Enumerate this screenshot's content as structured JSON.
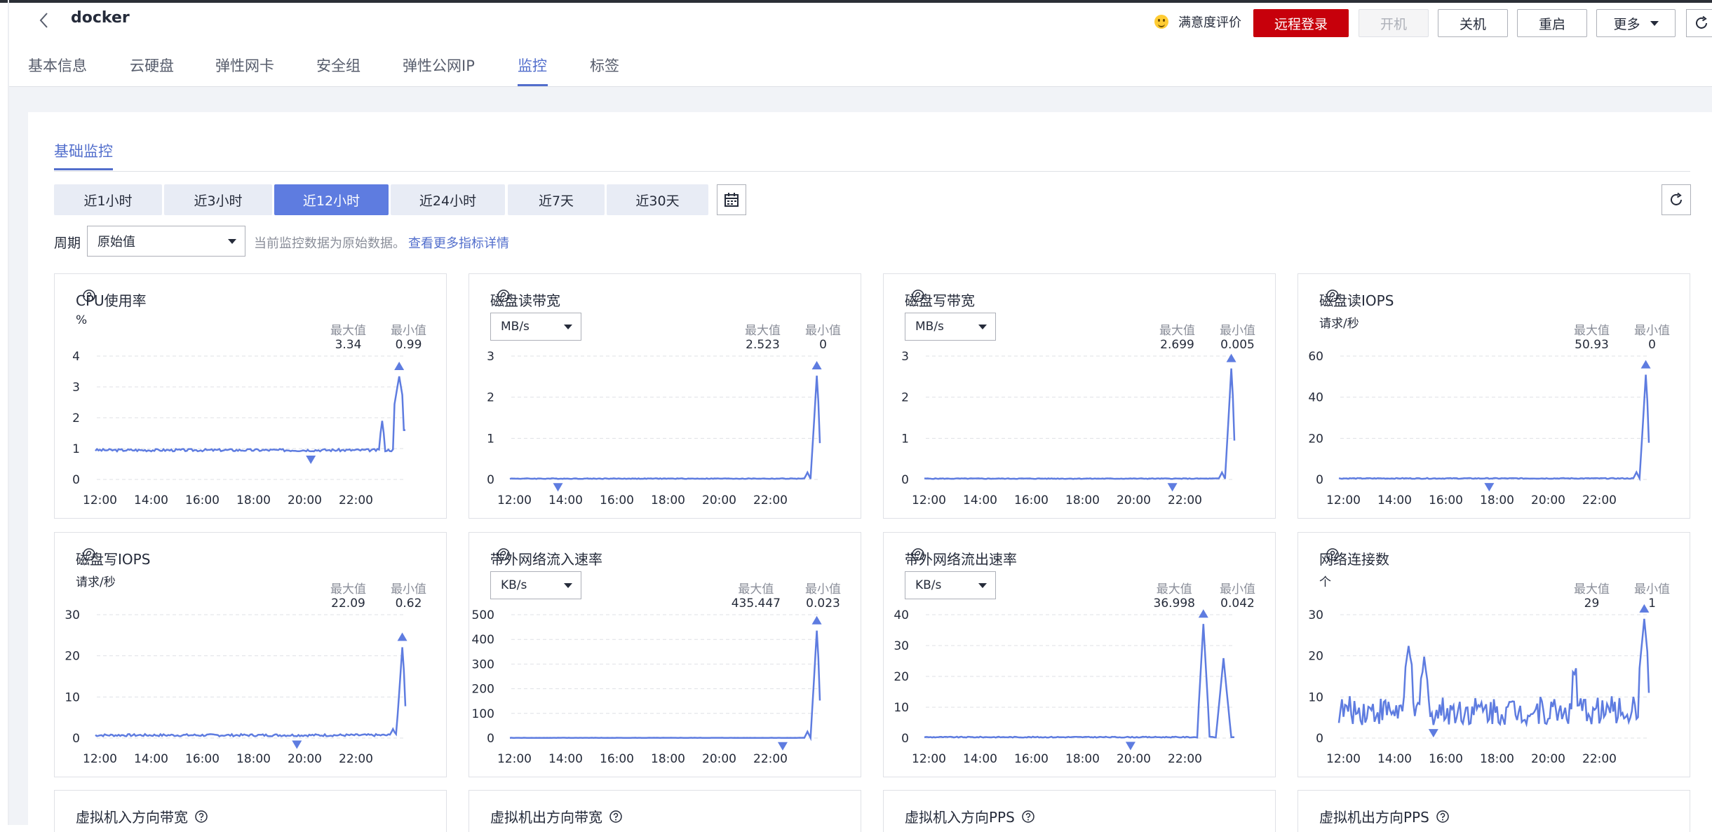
{
  "header": {
    "title": "docker",
    "satisfaction": "满意度评价",
    "buttons": {
      "remote_login": "远程登录",
      "start": "开机",
      "shutdown": "关机",
      "restart": "重启",
      "more": "更多"
    }
  },
  "tabs": [
    "基本信息",
    "云硬盘",
    "弹性网卡",
    "安全组",
    "弹性公网IP",
    "监控",
    "标签"
  ],
  "active_tab": "监控",
  "subtab": "基础监控",
  "ranges": [
    "近1小时",
    "近3小时",
    "近12小时",
    "近24小时",
    "近7天",
    "近30天"
  ],
  "active_range": "近12小时",
  "period": {
    "label": "周期",
    "value": "原始值",
    "hint": "当前监控数据为原始数据。",
    "link": "查看更多指标详情"
  },
  "stat_labels": {
    "max": "最大值",
    "min": "最小值"
  },
  "x_ticks": [
    "12:00",
    "14:00",
    "16:00",
    "18:00",
    "20:00",
    "22:00"
  ],
  "colors": {
    "accent": "#5e7ce0",
    "brand": "#c7000b",
    "link": "#526ecc"
  },
  "stub_titles": [
    "虚拟机入方向带宽",
    "虚拟机出方向带宽",
    "虚拟机入方向PPS",
    "虚拟机出方向PPS"
  ],
  "chart_data": [
    {
      "type": "line",
      "title": "CPU使用率",
      "unit": "%",
      "unit_select": false,
      "max": "3.34",
      "min": "0.99",
      "y_ticks": [
        0,
        1,
        2,
        3,
        4
      ],
      "ylim": [
        0,
        4
      ],
      "series": [
        {
          "shape": "cpu",
          "peak": 3.34,
          "base": 0.95
        }
      ]
    },
    {
      "type": "line",
      "title": "磁盘读带宽",
      "unit": "MB/s",
      "unit_select": true,
      "max": "2.523",
      "min": "0",
      "y_ticks": [
        0,
        1,
        2,
        3
      ],
      "ylim": [
        0,
        3
      ],
      "series": [
        {
          "shape": "spike",
          "peak": 2.523,
          "base": 0.02
        }
      ]
    },
    {
      "type": "line",
      "title": "磁盘写带宽",
      "unit": "MB/s",
      "unit_select": true,
      "max": "2.699",
      "min": "0.005",
      "y_ticks": [
        0,
        1,
        2,
        3
      ],
      "ylim": [
        0,
        3
      ],
      "series": [
        {
          "shape": "spike",
          "peak": 2.699,
          "base": 0.02
        }
      ]
    },
    {
      "type": "line",
      "title": "磁盘读IOPS",
      "unit": "请求/秒",
      "unit_select": false,
      "max": "50.93",
      "min": "0",
      "y_ticks": [
        0,
        20,
        40,
        60
      ],
      "ylim": [
        0,
        60
      ],
      "series": [
        {
          "shape": "spike",
          "peak": 50.93,
          "base": 0.5
        }
      ]
    },
    {
      "type": "line",
      "title": "磁盘写IOPS",
      "unit": "请求/秒",
      "unit_select": false,
      "max": "22.09",
      "min": "0.62",
      "y_ticks": [
        0,
        10,
        20,
        30
      ],
      "ylim": [
        0,
        30
      ],
      "series": [
        {
          "shape": "spike",
          "peak": 22.09,
          "base": 0.7
        }
      ]
    },
    {
      "type": "line",
      "title": "带外网络流入速率",
      "unit": "KB/s",
      "unit_select": true,
      "max": "435.447",
      "min": "0.023",
      "y_ticks": [
        0,
        100,
        200,
        300,
        400,
        500
      ],
      "ylim": [
        0,
        500
      ],
      "series": [
        {
          "shape": "spike",
          "peak": 435.447,
          "base": 1
        }
      ]
    },
    {
      "type": "line",
      "title": "带外网络流出速率",
      "unit": "KB/s",
      "unit_select": true,
      "max": "36.998",
      "min": "0.042",
      "y_ticks": [
        0,
        10,
        20,
        30,
        40
      ],
      "ylim": [
        0,
        40
      ],
      "series": [
        {
          "shape": "double",
          "peak": 36.998,
          "base": 0.3
        }
      ]
    },
    {
      "type": "line",
      "title": "网络连接数",
      "unit": "个",
      "unit_select": false,
      "max": "29",
      "min": "1",
      "y_ticks": [
        0,
        10,
        20,
        30
      ],
      "ylim": [
        0,
        30
      ],
      "series": [
        {
          "shape": "noisy",
          "peak": 29,
          "base": 6
        }
      ]
    }
  ]
}
